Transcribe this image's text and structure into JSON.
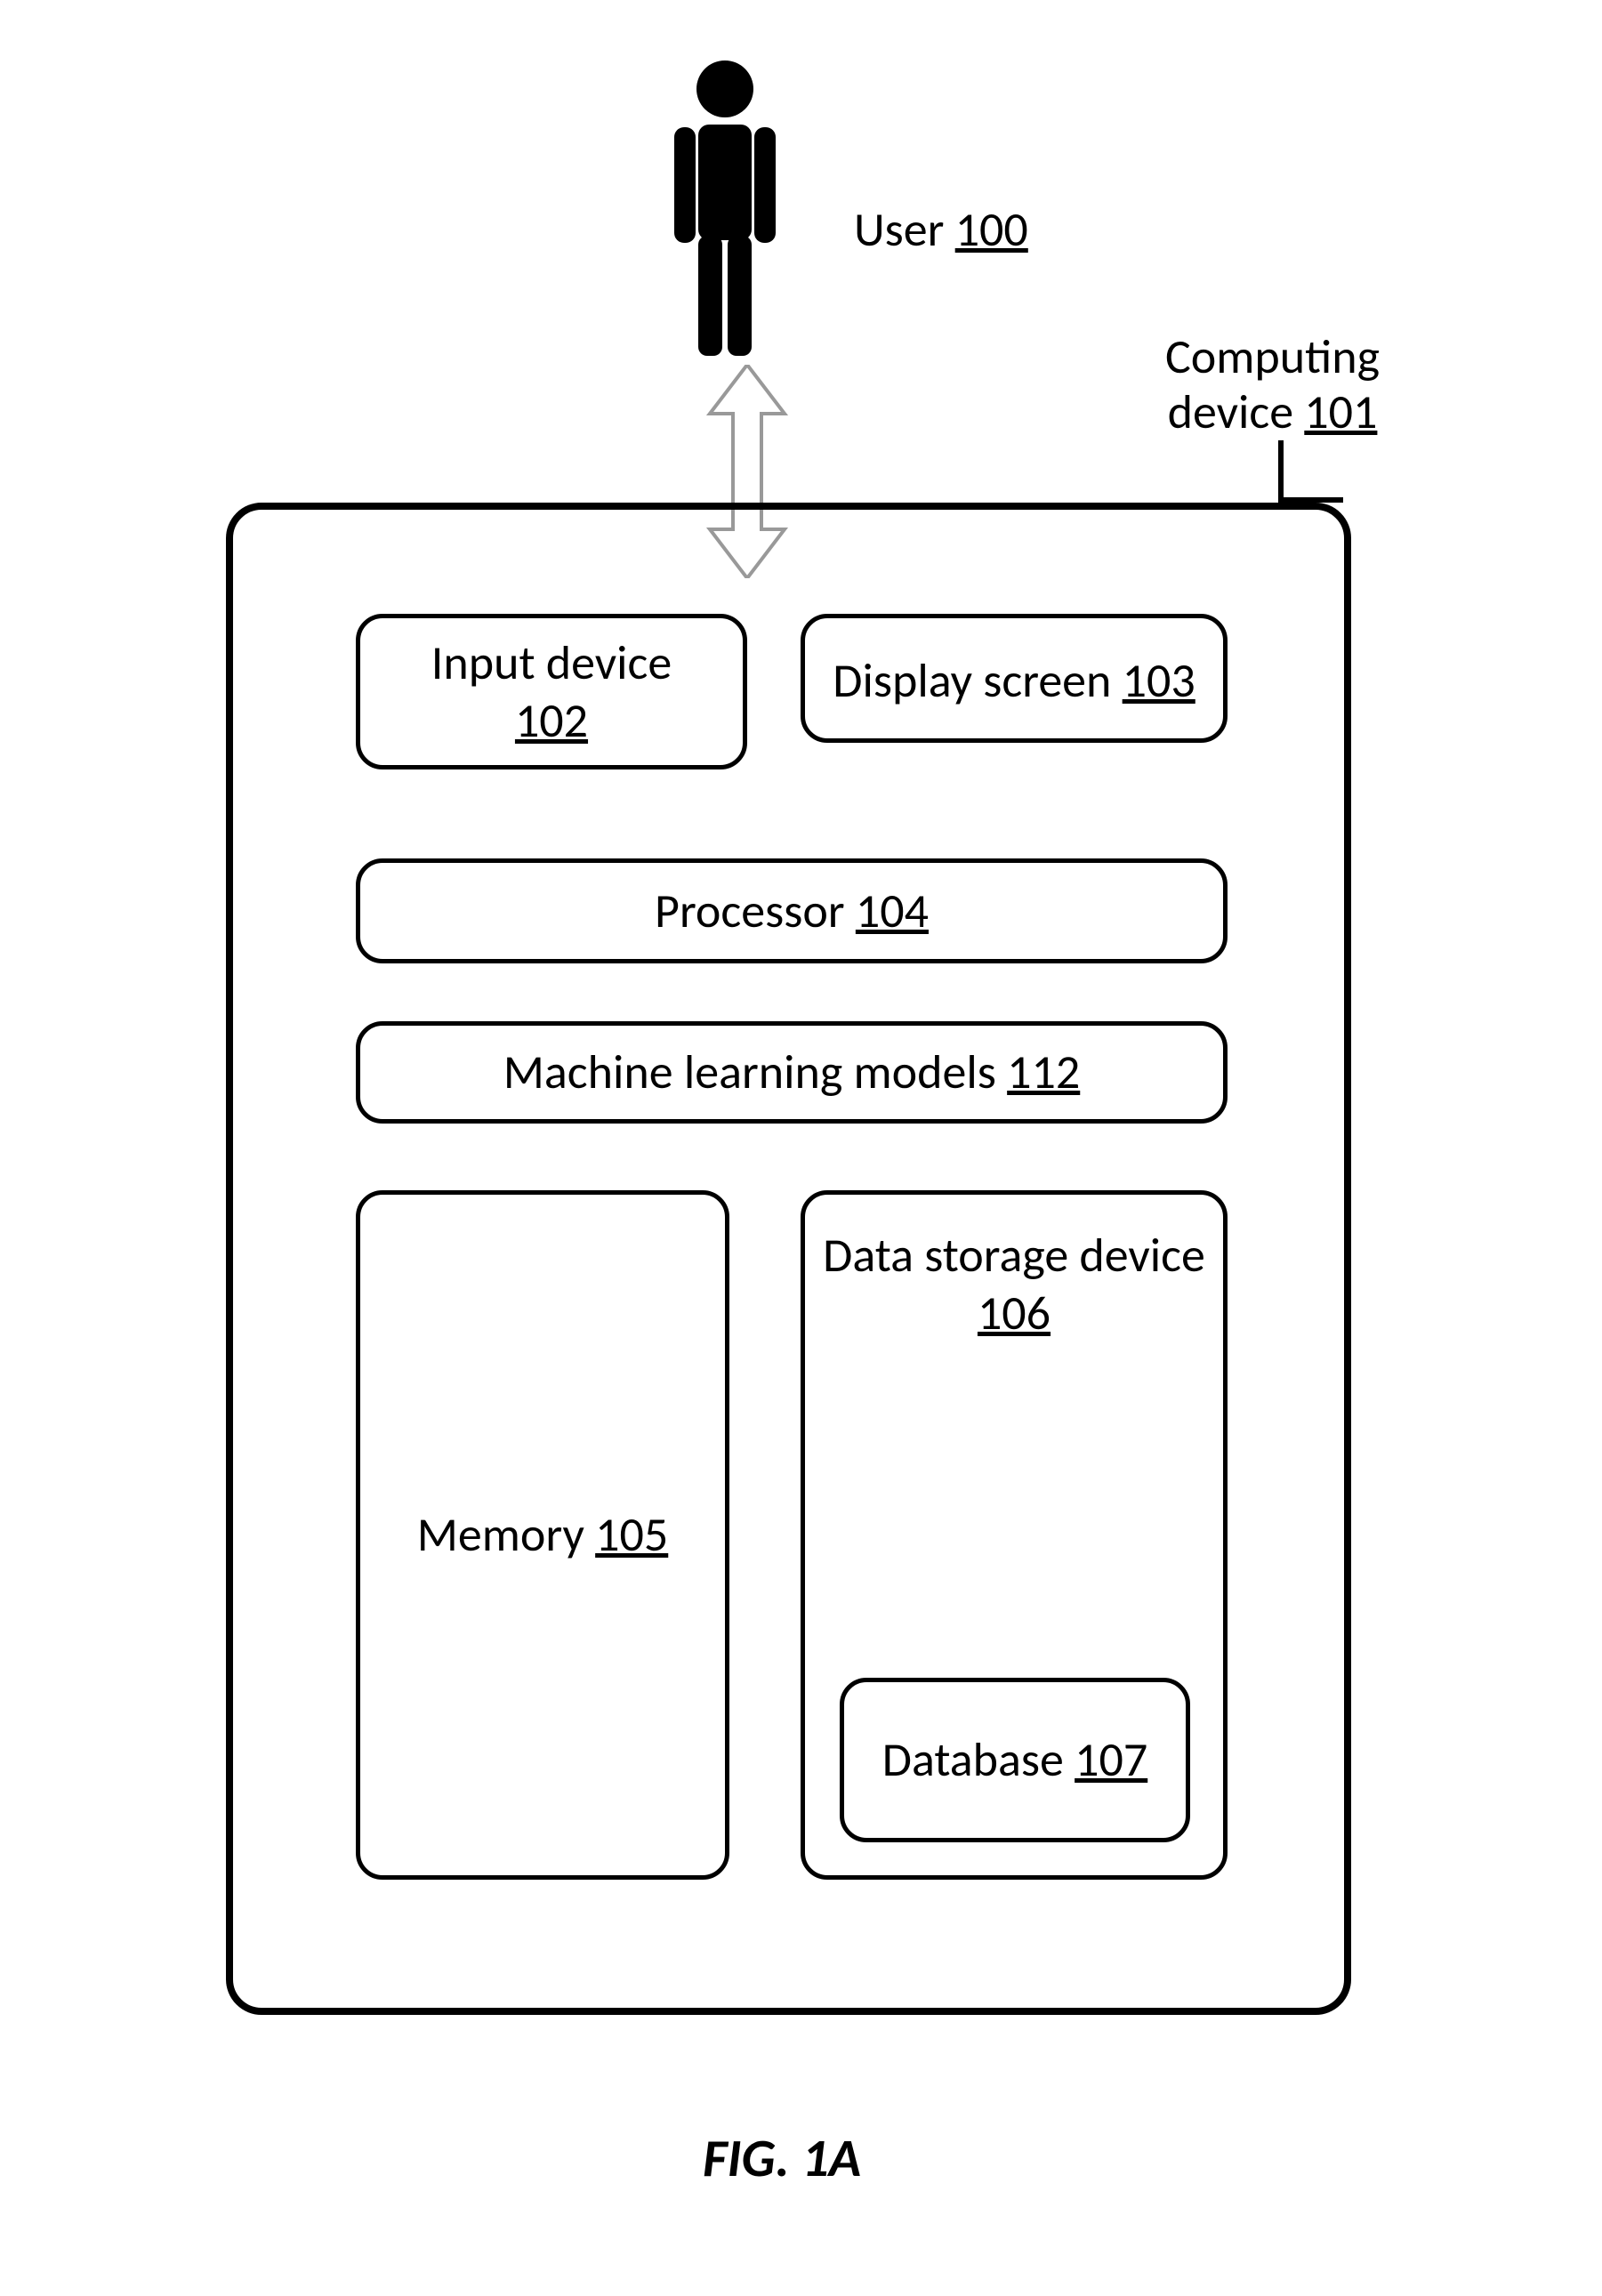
{
  "user": {
    "label": "User",
    "ref": "100"
  },
  "device": {
    "label": "Computing\ndevice",
    "ref": "101"
  },
  "components": {
    "input_device": {
      "label": "Input device",
      "ref": "102"
    },
    "display_screen": {
      "label": "Display screen",
      "ref": "103"
    },
    "processor": {
      "label": "Processor",
      "ref": "104"
    },
    "ml_models": {
      "label": "Machine learning models",
      "ref": "112"
    },
    "memory": {
      "label": "Memory",
      "ref": "105"
    },
    "storage": {
      "label": "Data storage device",
      "ref": "106"
    },
    "database": {
      "label": "Database",
      "ref": "107"
    }
  },
  "figure_caption": "FIG. 1A"
}
